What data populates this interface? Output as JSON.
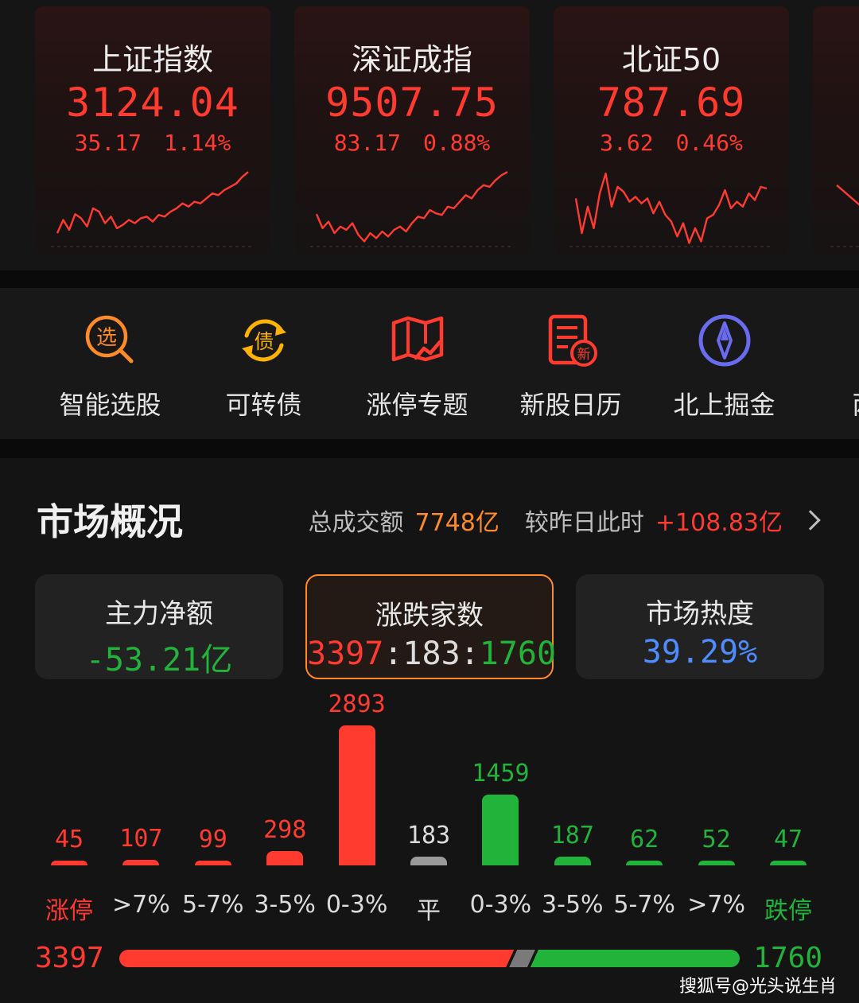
{
  "colors": {
    "up": "#ff3b30",
    "down": "#22b33a",
    "flat": "#9a9a9a",
    "accent": "#ff8a28",
    "heat": "#4f8dff"
  },
  "indices": [
    {
      "name": "上证指数",
      "value": "3124.04",
      "change": "35.17",
      "change_pct": "1.14%",
      "spark": [
        0.78,
        0.62,
        0.74,
        0.55,
        0.6,
        0.7,
        0.48,
        0.52,
        0.66,
        0.58,
        0.72,
        0.68,
        0.62,
        0.66,
        0.6,
        0.58,
        0.64,
        0.56,
        0.58,
        0.52,
        0.48,
        0.42,
        0.46,
        0.4,
        0.42,
        0.36,
        0.3,
        0.32,
        0.26,
        0.22,
        0.18,
        0.1,
        0.04
      ]
    },
    {
      "name": "深证成指",
      "value": "9507.75",
      "change": "83.17",
      "change_pct": "0.88%",
      "spark": [
        0.55,
        0.72,
        0.64,
        0.78,
        0.7,
        0.74,
        0.66,
        0.8,
        0.88,
        0.78,
        0.84,
        0.76,
        0.82,
        0.74,
        0.7,
        0.76,
        0.66,
        0.58,
        0.6,
        0.5,
        0.54,
        0.56,
        0.46,
        0.48,
        0.4,
        0.32,
        0.36,
        0.26,
        0.2,
        0.22,
        0.14,
        0.08,
        0.04
      ]
    },
    {
      "name": "北证50",
      "value": "787.69",
      "change": "3.62",
      "change_pct": "0.46%",
      "spark": [
        0.36,
        0.78,
        0.46,
        0.72,
        0.3,
        0.06,
        0.46,
        0.22,
        0.28,
        0.4,
        0.34,
        0.42,
        0.36,
        0.54,
        0.4,
        0.56,
        0.64,
        0.82,
        0.66,
        0.9,
        0.72,
        0.88,
        0.6,
        0.56,
        0.44,
        0.26,
        0.48,
        0.4,
        0.46,
        0.3,
        0.38,
        0.22,
        0.24
      ]
    },
    {
      "name": "",
      "value": "",
      "change": "",
      "change_pct": "",
      "spark": [
        0.2,
        0.7,
        0.8,
        0.72,
        0.86
      ]
    }
  ],
  "tools": [
    {
      "icon": "stock-picker-icon",
      "glyph": "选",
      "label": "智能选股",
      "color": "#ff8a28"
    },
    {
      "icon": "convertible-bond-icon",
      "glyph": "债",
      "label": "可转债",
      "color": "#ffb300"
    },
    {
      "icon": "limit-up-topic-icon",
      "glyph": "",
      "label": "涨停专题",
      "color": "#ff3b30"
    },
    {
      "icon": "ipo-calendar-icon",
      "glyph": "新",
      "label": "新股日历",
      "color": "#ff3b30"
    },
    {
      "icon": "compass-icon",
      "glyph": "",
      "label": "北上掘金",
      "color": "#6a6cf0"
    },
    {
      "icon": "margin-icon",
      "glyph": "",
      "label": "两融",
      "color": "#ff3b30"
    }
  ],
  "overview": {
    "title": "市场概况",
    "turnover_label": "总成交额",
    "turnover_value": "7748亿",
    "compare_label": "较昨日此时",
    "compare_value": "+108.83亿",
    "boxes": [
      {
        "label": "主力净额",
        "value": "-53.21亿",
        "color": "#22b33a"
      },
      {
        "label": "涨跌家数",
        "up": "3397",
        "sep": ":",
        "flat": "183",
        "down": "1760",
        "active": true
      },
      {
        "label": "市场热度",
        "value": "39.29%",
        "color": "#4f8dff"
      }
    ],
    "distribution": [
      {
        "label": "涨停",
        "count": 45,
        "kind": "up"
      },
      {
        "label": ">7%",
        "count": 107,
        "kind": "up"
      },
      {
        "label": "5-7%",
        "count": 99,
        "kind": "up"
      },
      {
        "label": "3-5%",
        "count": 298,
        "kind": "up"
      },
      {
        "label": "0-3%",
        "count": 2893,
        "kind": "up"
      },
      {
        "label": "平",
        "count": 183,
        "kind": "flat"
      },
      {
        "label": "0-3%",
        "count": 1459,
        "kind": "down"
      },
      {
        "label": "3-5%",
        "count": 187,
        "kind": "down"
      },
      {
        "label": "5-7%",
        "count": 62,
        "kind": "down"
      },
      {
        "label": ">7%",
        "count": 52,
        "kind": "down"
      },
      {
        "label": "跌停",
        "count": 47,
        "kind": "down"
      }
    ],
    "ratio": {
      "up": 3397,
      "flat": 183,
      "down": 1760
    }
  },
  "watermark": "搜狐号@光头说生肖"
}
